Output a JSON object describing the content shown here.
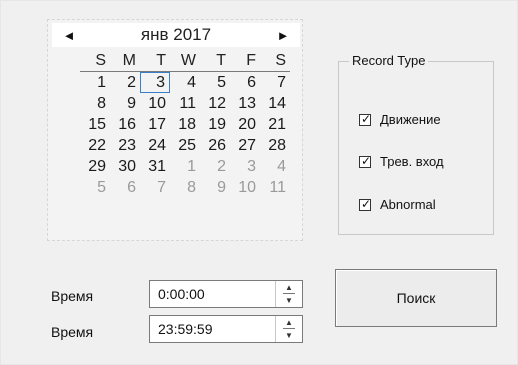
{
  "calendar": {
    "month_label": "янв 2017",
    "prev_icon": "◄",
    "next_icon": "►",
    "weekdays": [
      "S",
      "M",
      "T",
      "W",
      "T",
      "F",
      "S"
    ],
    "weeks": [
      [
        "1",
        "2",
        "3",
        "4",
        "5",
        "6",
        "7"
      ],
      [
        "8",
        "9",
        "10",
        "11",
        "12",
        "13",
        "14"
      ],
      [
        "15",
        "16",
        "17",
        "18",
        "19",
        "20",
        "21"
      ],
      [
        "22",
        "23",
        "24",
        "25",
        "26",
        "27",
        "28"
      ],
      [
        "29",
        "30",
        "31",
        "1",
        "2",
        "3",
        "4"
      ],
      [
        "5",
        "6",
        "7",
        "8",
        "9",
        "10",
        "11"
      ]
    ],
    "selected_day": "3",
    "other_month_color": "#9a9a9a",
    "selection_color": "#3a7ec8"
  },
  "record_type": {
    "title": "Record Type",
    "options": [
      {
        "label": "Движение",
        "checked": true
      },
      {
        "label": "Трев. вход",
        "checked": true
      },
      {
        "label": "Abnormal",
        "checked": true
      }
    ],
    "check_mark": "✓"
  },
  "time": {
    "start_label": "Время",
    "start_value": "0:00:00",
    "end_label": "Время",
    "end_value": "23:59:59",
    "spin_up_icon": "▲",
    "spin_down_icon": "▼"
  },
  "search": {
    "label": "Поиск"
  }
}
